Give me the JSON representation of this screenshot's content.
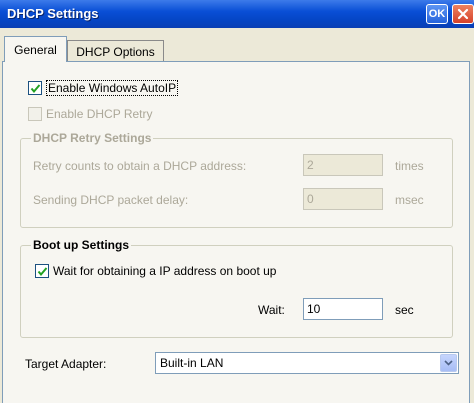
{
  "window": {
    "title": "DHCP Settings",
    "ok_label": "OK"
  },
  "tabs": [
    {
      "label": "General",
      "active": true
    },
    {
      "label": "DHCP Options",
      "active": false
    }
  ],
  "general": {
    "enable_autoip": {
      "label": "Enable Windows AutoIP",
      "checked": true,
      "enabled": true
    },
    "enable_dhcp_retry": {
      "label": "Enable DHCP Retry",
      "checked": false,
      "enabled": false
    },
    "retry_settings": {
      "title": "DHCP Retry Settings",
      "retry_counts": {
        "label": "Retry counts to obtain a DHCP address:",
        "value": "2",
        "unit": "times"
      },
      "packet_delay": {
        "label": "Sending DHCP packet delay:",
        "value": "0",
        "unit": "msec"
      }
    },
    "boot_settings": {
      "title": "Boot up Settings",
      "wait_for_ip": {
        "label": "Wait for obtaining a IP address on boot up",
        "checked": true
      },
      "wait": {
        "label": "Wait:",
        "value": "10",
        "unit": "sec"
      }
    },
    "target_adapter": {
      "label": "Target Adapter:",
      "selected": "Built-in LAN"
    }
  }
}
